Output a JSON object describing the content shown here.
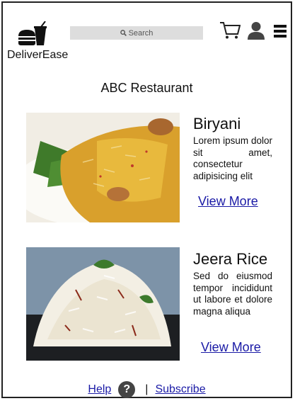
{
  "header": {
    "brand": "DeliverEase",
    "search_placeholder": "Search",
    "icons": [
      "burger-drink-logo-icon",
      "search-icon",
      "cart-icon",
      "user-icon",
      "menu-icon"
    ]
  },
  "restaurant": {
    "title": "ABC Restaurant"
  },
  "dishes": [
    {
      "name": "Biryani",
      "description": "Lorem ipsum dolor sit amet, consectetur adipisicing elit",
      "link": "View More"
    },
    {
      "name": "Jeera Rice",
      "description": "Sed do eiusmod tempor incididunt ut labore et dolore magna aliqua",
      "link": "View More"
    }
  ],
  "footer": {
    "help": "Help",
    "help_icon": "?",
    "separator": "|",
    "subscribe": "Subscribe"
  },
  "colors": {
    "link": "#1a1aa6",
    "search_bg": "#dddddd",
    "icon": "#222222"
  }
}
